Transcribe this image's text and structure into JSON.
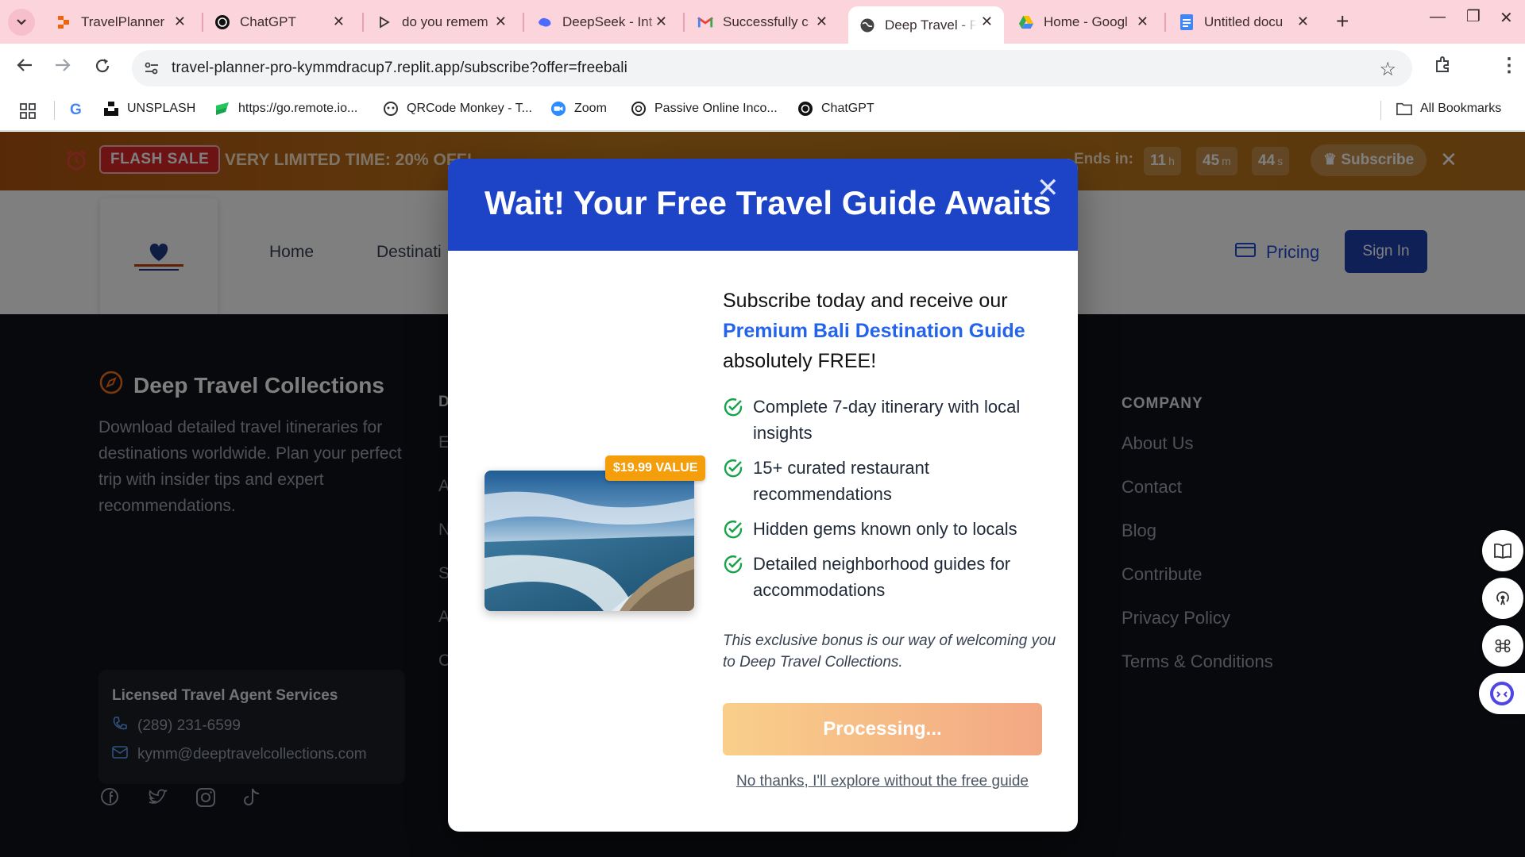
{
  "browser": {
    "tabs": [
      {
        "title": "TravelPlanner",
        "icon": "replit-icon"
      },
      {
        "title": "ChatGPT",
        "icon": "chatgpt-icon"
      },
      {
        "title": "do you remem",
        "icon": "generic-icon"
      },
      {
        "title": "DeepSeek - Int",
        "icon": "deepseek-icon"
      },
      {
        "title": "Successfully c",
        "icon": "gmail-icon"
      },
      {
        "title": "Deep Travel - P",
        "icon": "globe-icon",
        "active": true
      },
      {
        "title": "Home - Googl",
        "icon": "drive-icon"
      },
      {
        "title": "Untitled docu",
        "icon": "docs-icon"
      }
    ],
    "url": "travel-planner-pro-kymmdracup7.replit.app/subscribe?offer=freebali",
    "bookmarks": [
      {
        "label": "UNSPLASH",
        "icon": "unsplash-icon"
      },
      {
        "label": "https://go.remote.io...",
        "icon": "remote-icon"
      },
      {
        "label": "QRCode Monkey - T...",
        "icon": "qrcode-icon"
      },
      {
        "label": "Zoom",
        "icon": "zoom-icon"
      },
      {
        "label": "Passive Online Inco...",
        "icon": "chatgpt-icon"
      },
      {
        "label": "ChatGPT",
        "icon": "chatgpt-icon"
      }
    ],
    "all_bookmarks": "All Bookmarks"
  },
  "flash_sale": {
    "badge": "FLASH SALE",
    "text": "VERY LIMITED TIME:  20% OFF!",
    "ends_in": "Ends in:",
    "hours": "11",
    "hours_unit": "h",
    "minutes": "45",
    "minutes_unit": "m",
    "seconds": "44",
    "seconds_unit": "s",
    "subscribe": "Subscribe"
  },
  "header": {
    "nav": [
      "Home",
      "Destinati"
    ],
    "pricing": "Pricing",
    "sign_in": "Sign In"
  },
  "footer": {
    "brand": "Deep Travel Collections",
    "description": "Download detailed travel itineraries for destinations worldwide. Plan your perfect trip with insider tips and expert recommendations.",
    "card_title": "Licensed Travel Agent Services",
    "phone": "(289) 231-6599",
    "email": "kymm@deeptravelcollections.com",
    "col2_letters": [
      "D",
      "E",
      "A",
      "N",
      "S",
      "A",
      "C"
    ],
    "company_heading": "COMPANY",
    "company_links": [
      "About Us",
      "Contact",
      "Blog",
      "Contribute",
      "Privacy Policy",
      "Terms & Conditions"
    ]
  },
  "modal": {
    "title": "Wait! Your Free Travel Guide Awaits",
    "value_badge": "$19.99 VALUE",
    "lead_1": "Subscribe today and receive our",
    "lead_highlight": "Premium Bali Destination Guide",
    "lead_2": "absolutely FREE!",
    "features": [
      "Complete 7-day itinerary with local insights",
      "15+ curated restaurant recommendations",
      "Hidden gems known only to locals",
      "Detailed neighborhood guides for accommodations"
    ],
    "note": "This exclusive bonus is our way of welcoming you to Deep Travel Collections.",
    "button": "Processing...",
    "decline": "No thanks, I'll explore without the free guide"
  },
  "colors": {
    "tabstrip": "#fcd5dc",
    "modal_header": "#1d43c6",
    "highlight": "#2563eb",
    "badge": "#f59e0b",
    "check": "#16a34a"
  }
}
